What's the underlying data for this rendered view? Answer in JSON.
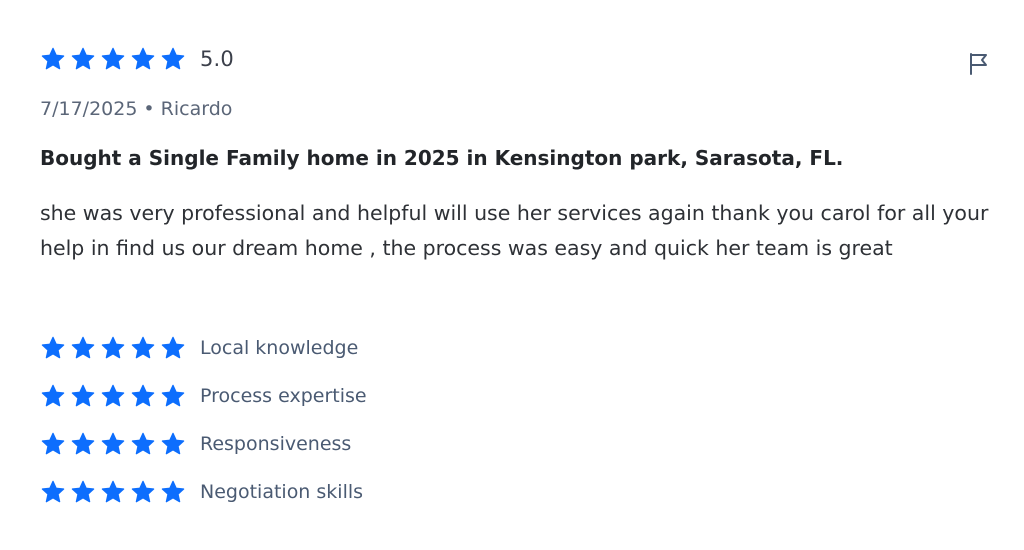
{
  "review": {
    "overall": {
      "stars": 5,
      "max_stars": 5,
      "score_text": "5.0"
    },
    "date": "7/17/2025",
    "separator": "•",
    "author": "Ricardo",
    "title": "Bought a Single Family home in 2025 in Kensington park, Sarasota, FL.",
    "text": "she was very professional and helpful will use her services again thank you carol for all your help in find us our dream home , the process was easy and quick her team is great",
    "subratings": [
      {
        "label": "Local knowledge",
        "stars": 5
      },
      {
        "label": "Process expertise",
        "stars": 5
      },
      {
        "label": "Responsiveness",
        "stars": 5
      },
      {
        "label": "Negotiation skills",
        "stars": 5
      }
    ],
    "actions": {
      "report_icon": "flag-icon"
    }
  },
  "colors": {
    "star": "#0d6efd",
    "title": "#222529",
    "meta": "#5b6678",
    "subrating_label": "#4a5a72"
  }
}
